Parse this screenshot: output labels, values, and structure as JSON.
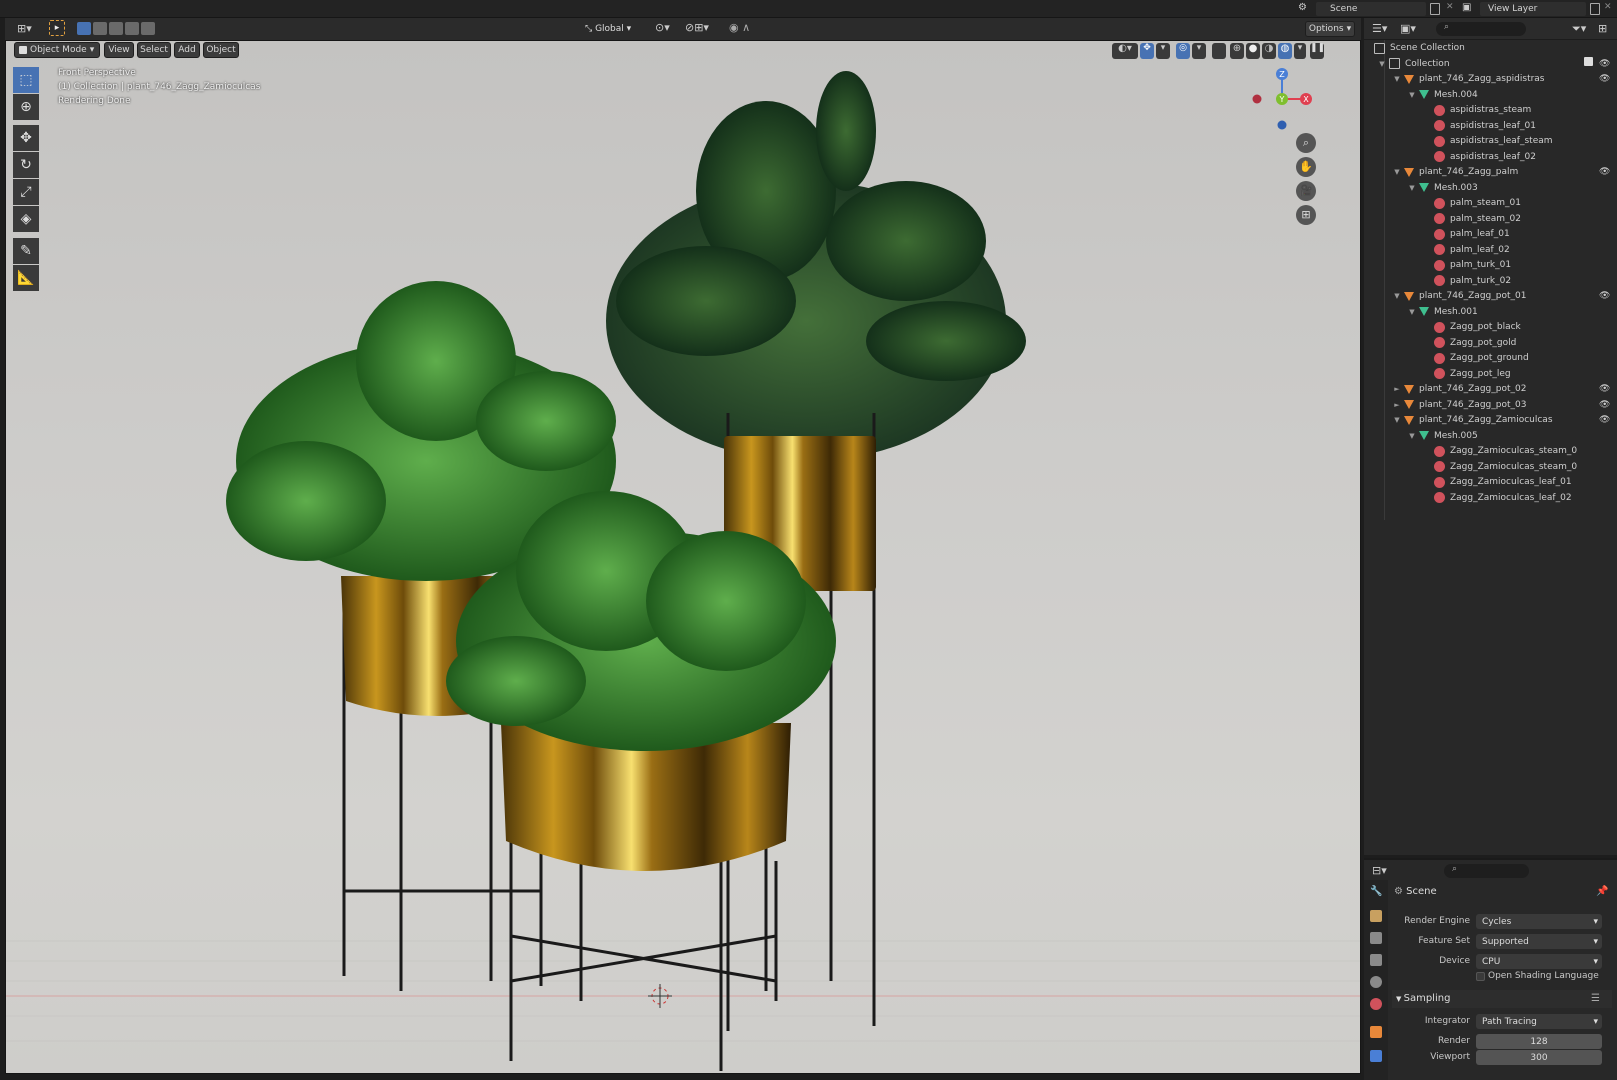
{
  "app": {
    "scene_name": "Scene",
    "view_layer_name": "View Layer"
  },
  "header": {
    "transform_orientation": "Global",
    "options_label": "Options"
  },
  "viewport_menu": {
    "mode": "Object Mode",
    "view": "View",
    "select": "Select",
    "add": "Add",
    "object": "Object"
  },
  "viewport_overlay": {
    "perspective": "Front Perspective",
    "collection_info": "(1) Collection | plant_746_Zagg_Zamioculcas",
    "status": "Rendering Done"
  },
  "gizmo": {
    "z": "Z",
    "y": "Y",
    "x": "X"
  },
  "outliner": {
    "rows": [
      {
        "label": "Scene Collection",
        "depth": 0,
        "icon": "scene-collection-icon",
        "tri": ""
      },
      {
        "label": "Collection",
        "depth": 1,
        "icon": "collection-icon",
        "tri": "▼"
      },
      {
        "label": "plant_746_Zagg_aspidistras",
        "depth": 2,
        "icon": "object-icon",
        "tri": "▼"
      },
      {
        "label": "Mesh.004",
        "depth": 3,
        "icon": "mesh-icon",
        "tri": "▼"
      },
      {
        "label": "aspidistras_steam",
        "depth": 4,
        "icon": "material-icon",
        "tri": ""
      },
      {
        "label": "aspidistras_leaf_01",
        "depth": 4,
        "icon": "material-icon",
        "tri": ""
      },
      {
        "label": "aspidistras_leaf_steam",
        "depth": 4,
        "icon": "material-icon",
        "tri": ""
      },
      {
        "label": "aspidistras_leaf_02",
        "depth": 4,
        "icon": "material-icon",
        "tri": ""
      },
      {
        "label": "plant_746_Zagg_palm",
        "depth": 2,
        "icon": "object-icon",
        "tri": "▼"
      },
      {
        "label": "Mesh.003",
        "depth": 3,
        "icon": "mesh-icon",
        "tri": "▼"
      },
      {
        "label": "palm_steam_01",
        "depth": 4,
        "icon": "material-icon",
        "tri": ""
      },
      {
        "label": "palm_steam_02",
        "depth": 4,
        "icon": "material-icon",
        "tri": ""
      },
      {
        "label": "palm_leaf_01",
        "depth": 4,
        "icon": "material-icon",
        "tri": ""
      },
      {
        "label": "palm_leaf_02",
        "depth": 4,
        "icon": "material-icon",
        "tri": ""
      },
      {
        "label": "palm_turk_01",
        "depth": 4,
        "icon": "material-icon",
        "tri": ""
      },
      {
        "label": "palm_turk_02",
        "depth": 4,
        "icon": "material-icon",
        "tri": ""
      },
      {
        "label": "plant_746_Zagg_pot_01",
        "depth": 2,
        "icon": "object-icon",
        "tri": "▼"
      },
      {
        "label": "Mesh.001",
        "depth": 3,
        "icon": "mesh-icon",
        "tri": "▼"
      },
      {
        "label": "Zagg_pot_black",
        "depth": 4,
        "icon": "material-icon",
        "tri": ""
      },
      {
        "label": "Zagg_pot_gold",
        "depth": 4,
        "icon": "material-icon",
        "tri": ""
      },
      {
        "label": "Zagg_pot_ground",
        "depth": 4,
        "icon": "material-icon",
        "tri": ""
      },
      {
        "label": "Zagg_pot_leg",
        "depth": 4,
        "icon": "material-icon",
        "tri": ""
      },
      {
        "label": "plant_746_Zagg_pot_02",
        "depth": 2,
        "icon": "object-icon",
        "tri": "►"
      },
      {
        "label": "plant_746_Zagg_pot_03",
        "depth": 2,
        "icon": "object-icon",
        "tri": "►"
      },
      {
        "label": "plant_746_Zagg_Zamioculcas",
        "depth": 2,
        "icon": "object-icon",
        "tri": "▼"
      },
      {
        "label": "Mesh.005",
        "depth": 3,
        "icon": "mesh-icon",
        "tri": "▼"
      },
      {
        "label": "Zagg_Zamioculcas_steam_0",
        "depth": 4,
        "icon": "material-icon",
        "tri": ""
      },
      {
        "label": "Zagg_Zamioculcas_steam_0",
        "depth": 4,
        "icon": "material-icon",
        "tri": ""
      },
      {
        "label": "Zagg_Zamioculcas_leaf_01",
        "depth": 4,
        "icon": "material-icon",
        "tri": ""
      },
      {
        "label": "Zagg_Zamioculcas_leaf_02",
        "depth": 4,
        "icon": "material-icon",
        "tri": ""
      }
    ]
  },
  "properties": {
    "context": "Scene",
    "render_engine_label": "Render Engine",
    "render_engine": "Cycles",
    "feature_set_label": "Feature Set",
    "feature_set": "Supported",
    "device_label": "Device",
    "device": "CPU",
    "osl_label": "Open Shading Language",
    "sampling_label": "Sampling",
    "integrator_label": "Integrator",
    "integrator": "Path Tracing",
    "render_label": "Render",
    "render_samples": "128",
    "viewport_label": "Viewport",
    "viewport_samples": "300"
  },
  "colors": {
    "accent": "#4772b3",
    "object_orange": "#e8883a",
    "mesh_green": "#3fbf8f",
    "material_red": "#d0525c"
  }
}
